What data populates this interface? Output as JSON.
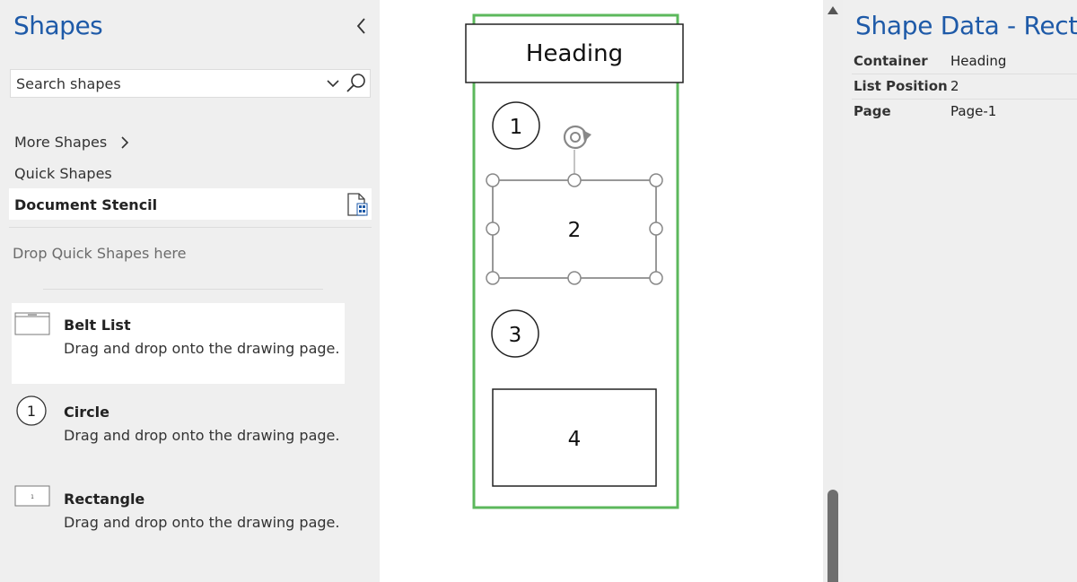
{
  "shapes_panel": {
    "title": "Shapes",
    "search": {
      "value": "Search shapes"
    },
    "nav": {
      "more_shapes": "More Shapes",
      "quick_shapes": "Quick Shapes",
      "document_stencil": "Document Stencil"
    },
    "drop_hint": "Drop Quick Shapes here",
    "items": [
      {
        "name": "Belt List",
        "description": "Drag and drop onto the drawing page.",
        "icon": "belt-list-icon",
        "selected": true
      },
      {
        "name": "Circle",
        "description": "Drag and drop onto the drawing page.",
        "icon": "circle-icon",
        "thumb_label": "1",
        "selected": false
      },
      {
        "name": "Rectangle",
        "description": "Drag and drop onto the drawing page.",
        "icon": "rectangle-icon",
        "thumb_label": "1",
        "selected": false
      }
    ]
  },
  "canvas": {
    "heading": "Heading",
    "list_items": [
      "1",
      "2",
      "3",
      "4"
    ],
    "container_color": "#5cb85c"
  },
  "shape_data": {
    "title": "Shape Data - Recta",
    "rows": [
      {
        "key": "Container",
        "value": "Heading"
      },
      {
        "key": "List Position",
        "value": "2"
      },
      {
        "key": "Page",
        "value": "Page-1"
      }
    ]
  },
  "colors": {
    "accent": "#1e5aa8",
    "panel_bg": "#efefef",
    "container_border": "#5cb85c"
  }
}
